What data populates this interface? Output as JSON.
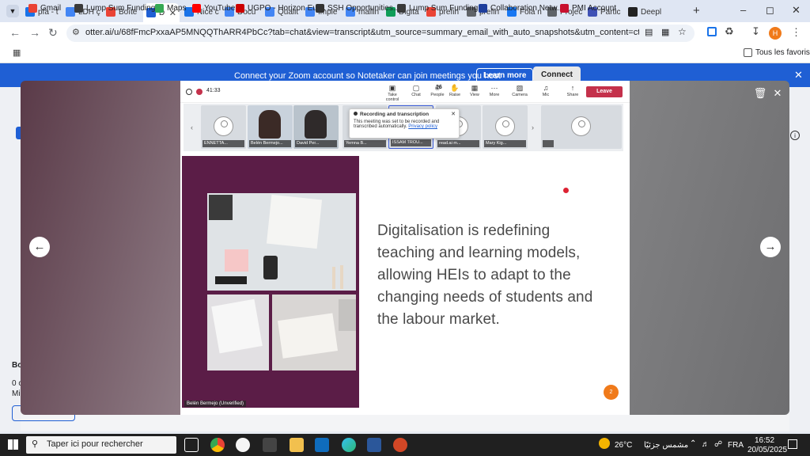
{
  "tabs": [
    {
      "label": "pfa - t",
      "color": "#1a73e8"
    },
    {
      "label": "LDH ç",
      "color": "#4285f4"
    },
    {
      "label": "Boîte",
      "color": "#ea4335"
    },
    {
      "label": "D",
      "color": "#1f5fd4",
      "active": true
    },
    {
      "label": "Nice c",
      "color": "#1a73e8"
    },
    {
      "label": "Docu",
      "color": "#4285f4"
    },
    {
      "label": "Qualit",
      "color": "#4285f4"
    },
    {
      "label": "Imple",
      "color": "#4285f4"
    },
    {
      "label": "mailin",
      "color": "#4285f4"
    },
    {
      "label": "Digita",
      "color": "#0f9d58"
    },
    {
      "label": "prefin",
      "color": "#ea4335"
    },
    {
      "label": "prefin",
      "color": "#5f6368"
    },
    {
      "label": "Fola n",
      "color": "#1877f2"
    },
    {
      "label": "Projec",
      "color": "#5f6368"
    },
    {
      "label": "Partic",
      "color": "#3f51b5"
    },
    {
      "label": "Deepl",
      "color": "#222"
    }
  ],
  "toolbar": {
    "url": "otter.ai/u/68fFmcPxxaAP5MNQQThARR4PbCc?tab=chat&view=transcript&utm_source=summary_email_with_auto_snapshots&utm_content=cta_summary&st=7VHhVS...",
    "profile_initial": "H"
  },
  "bookmarks": {
    "items": [
      "Gmail",
      "Lump Sum Funding...",
      "Maps",
      "YouTube",
      "UGPO - Horizon Eur...",
      "SSH Opportunities...",
      "Lump Sum Funding...",
      "Collaboration Netw...",
      "PMI Account"
    ],
    "all": "Tous les favoris"
  },
  "banner": {
    "text": "Connect your Zoom account so Notetaker can join meetings you host",
    "learn": "Learn more",
    "connect": "Connect"
  },
  "meeting": {
    "time": "41:33",
    "controls": [
      "Take control",
      "Chat",
      "People",
      "Raise",
      "View",
      "More",
      "Camera",
      "Mic",
      "Share"
    ],
    "people_count": "26",
    "leave": "Leave",
    "participants": [
      "ENNETTA...",
      "Belén Bermejo...",
      "David Per...",
      "Yemna B...",
      "ISSAM TROU...",
      "read.ai m...",
      "Mary Kig...",
      ""
    ],
    "popup": {
      "title": "Recording and transcription",
      "body": "This meeting was set to be recorded and transcribed automatically.",
      "link": "Privacy policy"
    },
    "slide_text": "Digitalisation is redefining teaching and learning models, allowing HEIs to adapt to the changing needs of students and the labour market.",
    "slide_badge": "2",
    "speaker": "Belén Bermejo (Unverified)"
  },
  "page_side": {
    "left_bottom": [
      "Bo",
      "0 c",
      "Mi"
    ]
  },
  "taskbar": {
    "search": "Taper ici pour rechercher",
    "weather": "26°C",
    "weather_text": "مشمس جزئيًا",
    "lang": "FRA",
    "time": "16:52",
    "date": "20/05/2025"
  }
}
